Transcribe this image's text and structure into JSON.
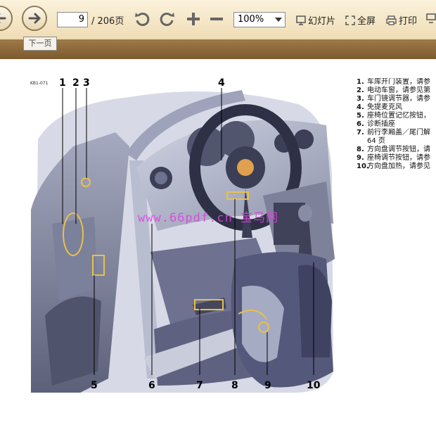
{
  "toolbar": {
    "page_current": "9",
    "page_total": "/ 206页",
    "zoom": "100%",
    "slideshow_label": "幻灯片",
    "fullscreen_label": "全屏",
    "print_label": "打印",
    "next_page_tooltip": "下一页"
  },
  "figure": {
    "code": "KB1-071",
    "callouts": [
      "1",
      "2",
      "3",
      "4",
      "5",
      "6",
      "7",
      "8",
      "9",
      "10"
    ],
    "watermark": "www.66pdf.cn 宝马网"
  },
  "legend": [
    {
      "n": "1.",
      "text": "车库开门装置，请参"
    },
    {
      "n": "2.",
      "text": "电动车窗，请参见第"
    },
    {
      "n": "3.",
      "text": "车门镜调节器，请参"
    },
    {
      "n": "4.",
      "text": "免提麦克风"
    },
    {
      "n": "5.",
      "text": "座椅位置记忆按钮，"
    },
    {
      "n": "6.",
      "text": "诊断插座"
    },
    {
      "n": "7.",
      "text": "前行李厢盖／尾门解"
    },
    {
      "n": "",
      "text": "64 页"
    },
    {
      "n": "8.",
      "text": "方向盘调节按钮，请"
    },
    {
      "n": "9.",
      "text": "座椅调节按钮，请参"
    },
    {
      "n": "10.",
      "text": "方向盘加热，请参见"
    }
  ]
}
